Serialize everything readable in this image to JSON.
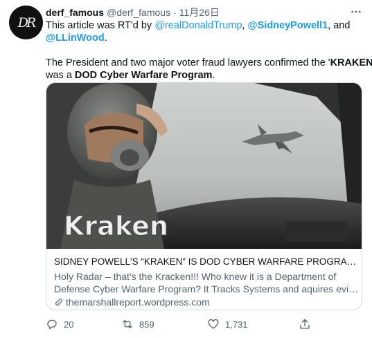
{
  "avatar": {
    "initials": "DR"
  },
  "header": {
    "display_name": "derf_famous",
    "handle": "@derf_famous",
    "separator": "·",
    "time": "11月26日"
  },
  "tweet": {
    "line1_prefix": "This article was RT'd by ",
    "mention1": "@realDonaldTrump",
    "line1_sep": ", ",
    "mention2": "@SidneyPowell1",
    "line1_suffix": ", and",
    "mention3": "@LLinWood",
    "line2_suffix": ".",
    "line3_prefix": "The President and two major voter fraud lawyers confirmed the '",
    "kraken": "KRAKEN",
    "line3_suffix": "'",
    "line4_prefix": "was a ",
    "dod": "DOD Cyber Warfare Program",
    "line4_suffix": "."
  },
  "card": {
    "image_overlay_text": "Kraken",
    "title": "SIDNEY POWELL'S “KRAKEN” IS DOD CYBER WARFARE PROGRAM! WE ...",
    "description_line1": "Holy Radar – that's the Kracken!!! Who knew it is a Department of",
    "description_line2": "Defense Cyber Warfare Program? It Tracks Systems and aquires evidenc...",
    "domain": "themarshallreport.wordpress.com"
  },
  "actions": {
    "reply_count": "20",
    "retweet_count": "859",
    "like_count": "1,731"
  },
  "colors": {
    "link": "#1d9bf0",
    "secondary_text": "#536471",
    "border": "#cfd9de"
  },
  "icons": {
    "more": "more-horizontal-icon",
    "link": "link-icon",
    "reply": "reply-icon",
    "retweet": "retweet-icon",
    "like": "like-icon",
    "share": "share-icon"
  }
}
